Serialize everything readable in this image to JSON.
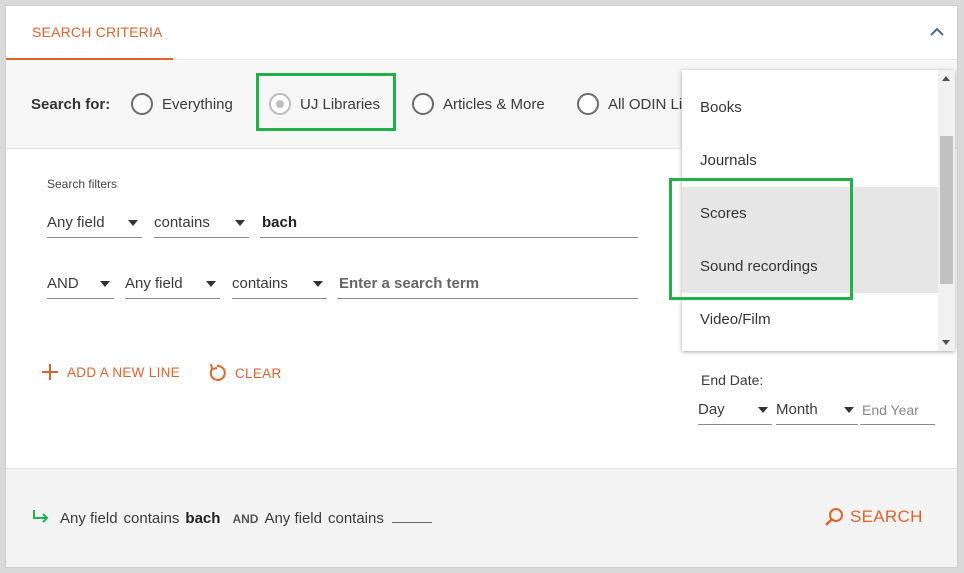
{
  "header": {
    "tab_label": "SEARCH CRITERIA"
  },
  "search_for": {
    "label": "Search for:",
    "options": [
      {
        "label": "Everything",
        "selected": false
      },
      {
        "label": "UJ Libraries",
        "selected": true
      },
      {
        "label": "Articles & More",
        "selected": false
      },
      {
        "label": "All ODIN Li",
        "selected": false
      }
    ]
  },
  "filters": {
    "title": "Search filters",
    "row1": {
      "field": "Any field",
      "condition": "contains",
      "value": "bach"
    },
    "row2": {
      "operator": "AND",
      "field": "Any field",
      "condition": "contains",
      "placeholder": "Enter a search term"
    }
  },
  "actions": {
    "add_line": "ADD A NEW LINE",
    "clear": "CLEAR"
  },
  "end_date": {
    "label": "End Date:",
    "day": "Day",
    "month": "Month",
    "year_placeholder": "End Year"
  },
  "dropdown": {
    "items": [
      "Books",
      "Journals",
      "Scores",
      "Sound recordings",
      "Video/Film"
    ],
    "highlighted": [
      "Scores",
      "Sound recordings"
    ]
  },
  "footer": {
    "summary": {
      "field1": "Any field",
      "cond1": "contains",
      "value1": "bach",
      "operator": "AND",
      "field2": "Any field",
      "cond2": "contains"
    },
    "search_label": "SEARCH"
  },
  "colors": {
    "accent": "#e0632c",
    "highlight_box": "#22b04b",
    "summary_arrow": "#22b04b"
  }
}
